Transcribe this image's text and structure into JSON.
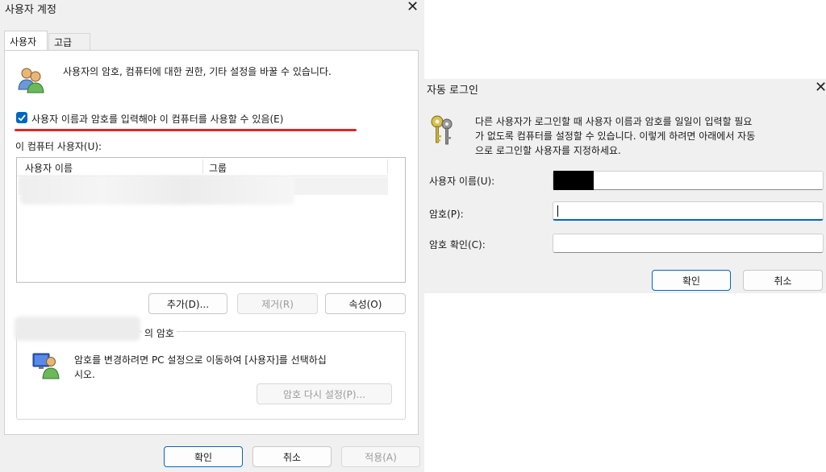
{
  "user_accounts": {
    "title": "사용자 계정",
    "tabs": [
      {
        "label": "사용자"
      },
      {
        "label": "고급"
      }
    ],
    "intro_text": "사용자의 암호, 컴퓨터에 대한 권한, 기타 설정을 바꿀 수 있습니다.",
    "checkbox_label": "사용자 이름과 암호를 입력해야 이 컴퓨터를 사용할 수 있음(E)",
    "checkbox_checked": true,
    "users_label": "이 컴퓨터 사용자(U):",
    "table": {
      "columns": [
        "사용자 이름",
        "그룹"
      ]
    },
    "buttons": {
      "add": "추가(D)...",
      "remove": "제거(R)",
      "properties": "속성(O)"
    },
    "password_group_title": "의 암호",
    "password_text_line1": "암호를 변경하려면 PC 설정으로 이동하여 [사용자]를 선택하십",
    "password_text_line2": "시오.",
    "reset_password": "암호 다시 설정(P)...",
    "ok": "확인",
    "cancel": "취소",
    "apply": "적용(A)"
  },
  "auto_logon": {
    "title": "자동 로그인",
    "desc_line1": "다른 사용자가 로그인할 때 사용자 이름과 암호를 일일이 입력할 필요",
    "desc_line2": "가 없도록 컴퓨터를 설정할 수 있습니다. 이렇게 하려면 아래에서 자동",
    "desc_line3": "으로 로그인할 사용자를 지정하세요.",
    "username_label": "사용자 이름(U):",
    "password_label": "암호(P):",
    "confirm_label": "암호 확인(C):",
    "ok": "확인",
    "cancel": "취소"
  },
  "colors": {
    "accent": "#0067c0",
    "annotation": "#e0262a",
    "dialog_bg": "#f0f0f0"
  }
}
